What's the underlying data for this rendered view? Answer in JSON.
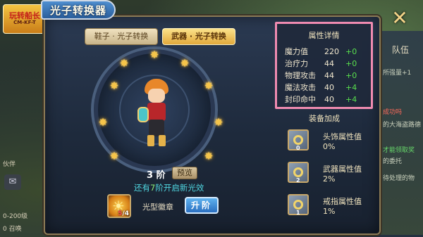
{
  "window": {
    "title": "光子转换器",
    "close_glyph": "✕"
  },
  "logo": {
    "text": "玩转船长",
    "sub": "CM-KF-T"
  },
  "background": {
    "team_label": "队伍",
    "right_lines": [
      "所强量+1",
      "的大海盗路德",
      "成功吗",
      "才能领取奖",
      "的委托",
      "待处理的物"
    ],
    "left_notes": [
      "伙伴",
      "0-200级",
      "0 召唤"
    ]
  },
  "tabs": {
    "shoes": "鞋子 · 光子转换",
    "weapon": "武器 · 光子转换",
    "active": "weapon"
  },
  "conversion": {
    "rank_label": "3 阶",
    "preview_label": "预览",
    "unlock_prefix": "还有",
    "unlock_count": "7",
    "unlock_suffix": "阶开启新光效",
    "badge_name": "光型徽章",
    "badge_have": "5",
    "badge_need": "4",
    "upgrade_label": "升阶"
  },
  "attributes": {
    "title": "属性详情",
    "rows": [
      {
        "name": "魔力值",
        "value": "220",
        "bonus": "+0"
      },
      {
        "name": "治疗力",
        "value": "44",
        "bonus": "+0"
      },
      {
        "name": "物理攻击",
        "value": "44",
        "bonus": "+0"
      },
      {
        "name": "魔法攻击",
        "value": "40",
        "bonus": "+4"
      },
      {
        "name": "封印命中",
        "value": "40",
        "bonus": "+4"
      }
    ]
  },
  "equipment": {
    "title": "装备加成",
    "slots": [
      {
        "name": "头饰属性值",
        "value": "0%",
        "level": "0"
      },
      {
        "name": "武器属性值",
        "value": "2%",
        "level": "2"
      },
      {
        "name": "戒指属性值",
        "value": "1%",
        "level": "1"
      }
    ]
  },
  "colors": {
    "accent_pink": "#f08bb1",
    "bonus_green": "#59e04d",
    "cyan_text": "#4fd6e0",
    "gold": "#f6c54a"
  },
  "icons": [
    "close-icon",
    "star-icon",
    "sun-badge-icon",
    "ring-equip-icon",
    "chat-icon"
  ]
}
